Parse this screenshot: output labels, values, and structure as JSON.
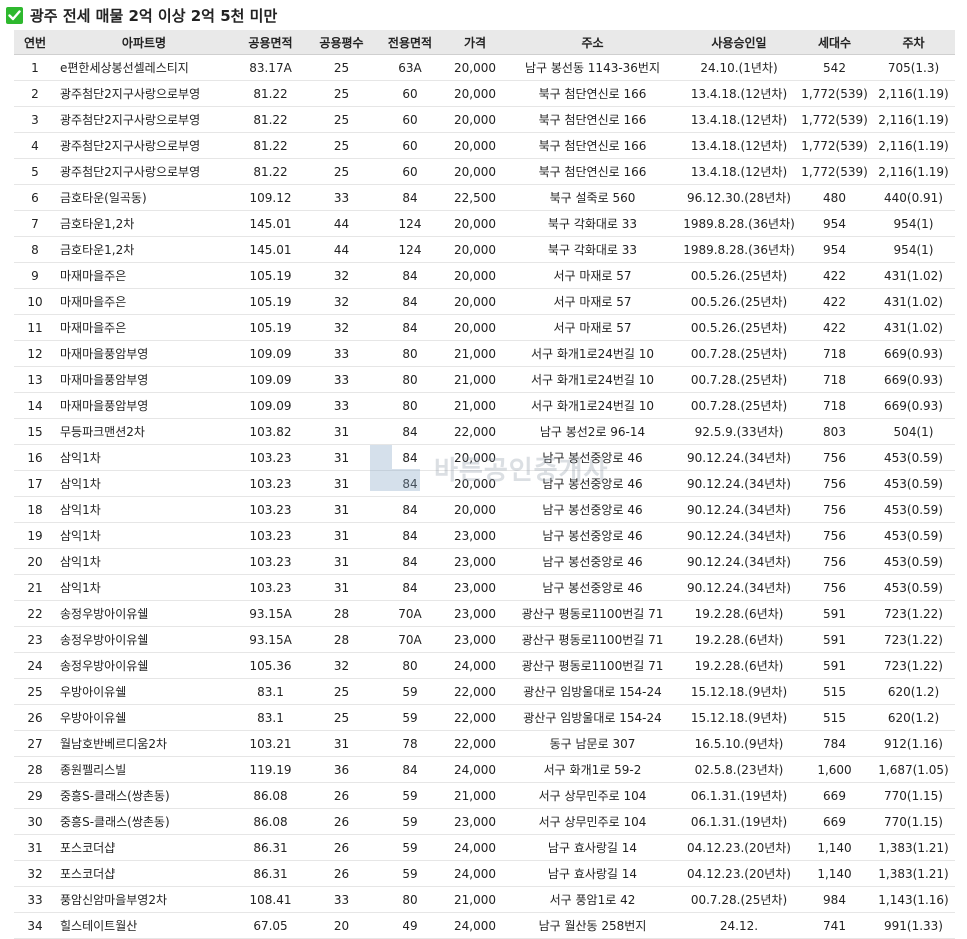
{
  "title": "광주 전세 매물 2억 이상 2억 5천 미만",
  "colors": {
    "check_bg": "#2eb82e",
    "header_bg": "#e9e9e9",
    "accent": "#2eb82e"
  },
  "icons": {
    "title_icon": "check-icon"
  },
  "table": {
    "headers": [
      "연번",
      "아파트명",
      "공용면적",
      "공용평수",
      "전용면적",
      "가격",
      "주소",
      "사용승인일",
      "세대수",
      "주차"
    ],
    "rows": [
      [
        "1",
        "e편한세상봉선셀레스티지",
        "83.17A",
        "25",
        "63A",
        "20,000",
        "남구 봉선동 1143-36번지",
        "24.10.(1년차)",
        "542",
        "705(1.3)"
      ],
      [
        "2",
        "광주첨단2지구사랑으로부영",
        "81.22",
        "25",
        "60",
        "20,000",
        "북구 첨단연신로 166",
        "13.4.18.(12년차)",
        "1,772(539)",
        "2,116(1.19)"
      ],
      [
        "3",
        "광주첨단2지구사랑으로부영",
        "81.22",
        "25",
        "60",
        "20,000",
        "북구 첨단연신로 166",
        "13.4.18.(12년차)",
        "1,772(539)",
        "2,116(1.19)"
      ],
      [
        "4",
        "광주첨단2지구사랑으로부영",
        "81.22",
        "25",
        "60",
        "20,000",
        "북구 첨단연신로 166",
        "13.4.18.(12년차)",
        "1,772(539)",
        "2,116(1.19)"
      ],
      [
        "5",
        "광주첨단2지구사랑으로부영",
        "81.22",
        "25",
        "60",
        "20,000",
        "북구 첨단연신로 166",
        "13.4.18.(12년차)",
        "1,772(539)",
        "2,116(1.19)"
      ],
      [
        "6",
        "금호타운(일곡동)",
        "109.12",
        "33",
        "84",
        "22,500",
        "북구 설죽로 560",
        "96.12.30.(28년차)",
        "480",
        "440(0.91)"
      ],
      [
        "7",
        "금호타운1,2차",
        "145.01",
        "44",
        "124",
        "20,000",
        "북구 각화대로 33",
        "1989.8.28.(36년차)",
        "954",
        "954(1)"
      ],
      [
        "8",
        "금호타운1,2차",
        "145.01",
        "44",
        "124",
        "20,000",
        "북구 각화대로 33",
        "1989.8.28.(36년차)",
        "954",
        "954(1)"
      ],
      [
        "9",
        "마재마을주은",
        "105.19",
        "32",
        "84",
        "20,000",
        "서구 마재로 57",
        "00.5.26.(25년차)",
        "422",
        "431(1.02)"
      ],
      [
        "10",
        "마재마을주은",
        "105.19",
        "32",
        "84",
        "20,000",
        "서구 마재로 57",
        "00.5.26.(25년차)",
        "422",
        "431(1.02)"
      ],
      [
        "11",
        "마재마을주은",
        "105.19",
        "32",
        "84",
        "20,000",
        "서구 마재로 57",
        "00.5.26.(25년차)",
        "422",
        "431(1.02)"
      ],
      [
        "12",
        "마재마을풍암부영",
        "109.09",
        "33",
        "80",
        "21,000",
        "서구 화개1로24번길 10",
        "00.7.28.(25년차)",
        "718",
        "669(0.93)"
      ],
      [
        "13",
        "마재마을풍암부영",
        "109.09",
        "33",
        "80",
        "21,000",
        "서구 화개1로24번길 10",
        "00.7.28.(25년차)",
        "718",
        "669(0.93)"
      ],
      [
        "14",
        "마재마을풍암부영",
        "109.09",
        "33",
        "80",
        "21,000",
        "서구 화개1로24번길 10",
        "00.7.28.(25년차)",
        "718",
        "669(0.93)"
      ],
      [
        "15",
        "무등파크맨션2차",
        "103.82",
        "31",
        "84",
        "22,000",
        "남구 봉선2로 96-14",
        "92.5.9.(33년차)",
        "803",
        "504(1)"
      ],
      [
        "16",
        "삼익1차",
        "103.23",
        "31",
        "84",
        "20,000",
        "남구 봉선중앙로 46",
        "90.12.24.(34년차)",
        "756",
        "453(0.59)"
      ],
      [
        "17",
        "삼익1차",
        "103.23",
        "31",
        "84",
        "20,000",
        "남구 봉선중앙로 46",
        "90.12.24.(34년차)",
        "756",
        "453(0.59)"
      ],
      [
        "18",
        "삼익1차",
        "103.23",
        "31",
        "84",
        "20,000",
        "남구 봉선중앙로 46",
        "90.12.24.(34년차)",
        "756",
        "453(0.59)"
      ],
      [
        "19",
        "삼익1차",
        "103.23",
        "31",
        "84",
        "23,000",
        "남구 봉선중앙로 46",
        "90.12.24.(34년차)",
        "756",
        "453(0.59)"
      ],
      [
        "20",
        "삼익1차",
        "103.23",
        "31",
        "84",
        "23,000",
        "남구 봉선중앙로 46",
        "90.12.24.(34년차)",
        "756",
        "453(0.59)"
      ],
      [
        "21",
        "삼익1차",
        "103.23",
        "31",
        "84",
        "23,000",
        "남구 봉선중앙로 46",
        "90.12.24.(34년차)",
        "756",
        "453(0.59)"
      ],
      [
        "22",
        "송정우방아이유쉘",
        "93.15A",
        "28",
        "70A",
        "23,000",
        "광산구 평동로1100번길 71",
        "19.2.28.(6년차)",
        "591",
        "723(1.22)"
      ],
      [
        "23",
        "송정우방아이유쉘",
        "93.15A",
        "28",
        "70A",
        "23,000",
        "광산구 평동로1100번길 71",
        "19.2.28.(6년차)",
        "591",
        "723(1.22)"
      ],
      [
        "24",
        "송정우방아이유쉘",
        "105.36",
        "32",
        "80",
        "24,000",
        "광산구 평동로1100번길 71",
        "19.2.28.(6년차)",
        "591",
        "723(1.22)"
      ],
      [
        "25",
        "우방아이유쉘",
        "83.1",
        "25",
        "59",
        "22,000",
        "광산구 임방울대로 154-24",
        "15.12.18.(9년차)",
        "515",
        "620(1.2)"
      ],
      [
        "26",
        "우방아이유쉘",
        "83.1",
        "25",
        "59",
        "22,000",
        "광산구 임방울대로 154-24",
        "15.12.18.(9년차)",
        "515",
        "620(1.2)"
      ],
      [
        "27",
        "월남호반베르디움2차",
        "103.21",
        "31",
        "78",
        "22,000",
        "동구 남문로 307",
        "16.5.10.(9년차)",
        "784",
        "912(1.16)"
      ],
      [
        "28",
        "종원펠리스빌",
        "119.19",
        "36",
        "84",
        "24,000",
        "서구 화개1로 59-2",
        "02.5.8.(23년차)",
        "1,600",
        "1,687(1.05)"
      ],
      [
        "29",
        "중흥S-클래스(쌍촌동)",
        "86.08",
        "26",
        "59",
        "21,000",
        "서구 상무민주로 104",
        "06.1.31.(19년차)",
        "669",
        "770(1.15)"
      ],
      [
        "30",
        "중흥S-클래스(쌍촌동)",
        "86.08",
        "26",
        "59",
        "23,000",
        "서구 상무민주로 104",
        "06.1.31.(19년차)",
        "669",
        "770(1.15)"
      ],
      [
        "31",
        "포스코더샵",
        "86.31",
        "26",
        "59",
        "24,000",
        "남구 효사랑길 14",
        "04.12.23.(20년차)",
        "1,140",
        "1,383(1.21)"
      ],
      [
        "32",
        "포스코더샵",
        "86.31",
        "26",
        "59",
        "24,000",
        "남구 효사랑길 14",
        "04.12.23.(20년차)",
        "1,140",
        "1,383(1.21)"
      ],
      [
        "33",
        "풍암신암마을부영2차",
        "108.41",
        "33",
        "80",
        "21,000",
        "서구 풍암1로 42",
        "00.7.28.(25년차)",
        "984",
        "1,143(1.16)"
      ],
      [
        "34",
        "힐스테이트월산",
        "67.05",
        "20",
        "49",
        "24,000",
        "남구 월산동 258번지",
        "24.12.",
        "741",
        "991(1.33)"
      ]
    ]
  },
  "watermark": {
    "text": "바른공인중개사"
  }
}
